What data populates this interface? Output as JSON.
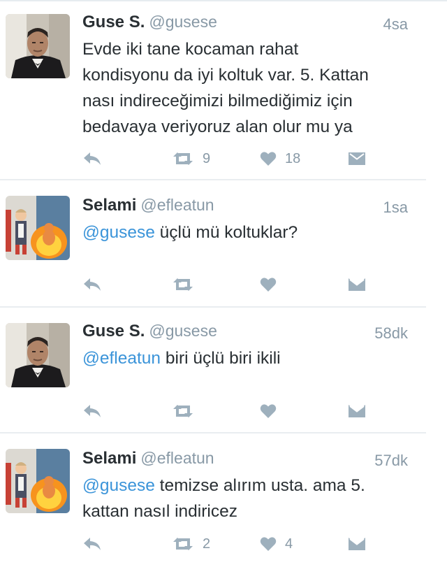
{
  "tweets": [
    {
      "name": "Guse S.",
      "handle": "@gusese",
      "time": "4sa",
      "text_lines": [
        "Evde iki tane kocaman rahat",
        "kondisyonu da iyi koltuk var. 5. Kattan",
        "nası indireceğimizi bilmediğimiz için",
        "bedavaya veriyoruz alan olur mu ya"
      ],
      "retweets": "9",
      "likes": "18"
    },
    {
      "name": "Selami",
      "handle": "@efleatun",
      "time": "1sa",
      "mention": "@gusese",
      "text": " üçlü mü koltuklar?",
      "retweets": "",
      "likes": ""
    },
    {
      "name": "Guse S.",
      "handle": "@gusese",
      "time": "58dk",
      "mention": "@efleatun",
      "text": " biri üçlü biri ikili",
      "retweets": "",
      "likes": ""
    },
    {
      "name": "Selami",
      "handle": "@efleatun",
      "time": "57dk",
      "mention": "@gusese",
      "text": " temizse alırım usta. ama 5.",
      "text_line2": "kattan nasıl indiricez",
      "retweets": "2",
      "likes": "4"
    }
  ],
  "colors": {
    "mention": "#3b94d9",
    "muted": "#8899a6",
    "icon": "#9eb0bd",
    "text": "#292f33"
  },
  "icons": [
    "reply-icon",
    "retweet-icon",
    "heart-icon",
    "direct-message-icon"
  ]
}
